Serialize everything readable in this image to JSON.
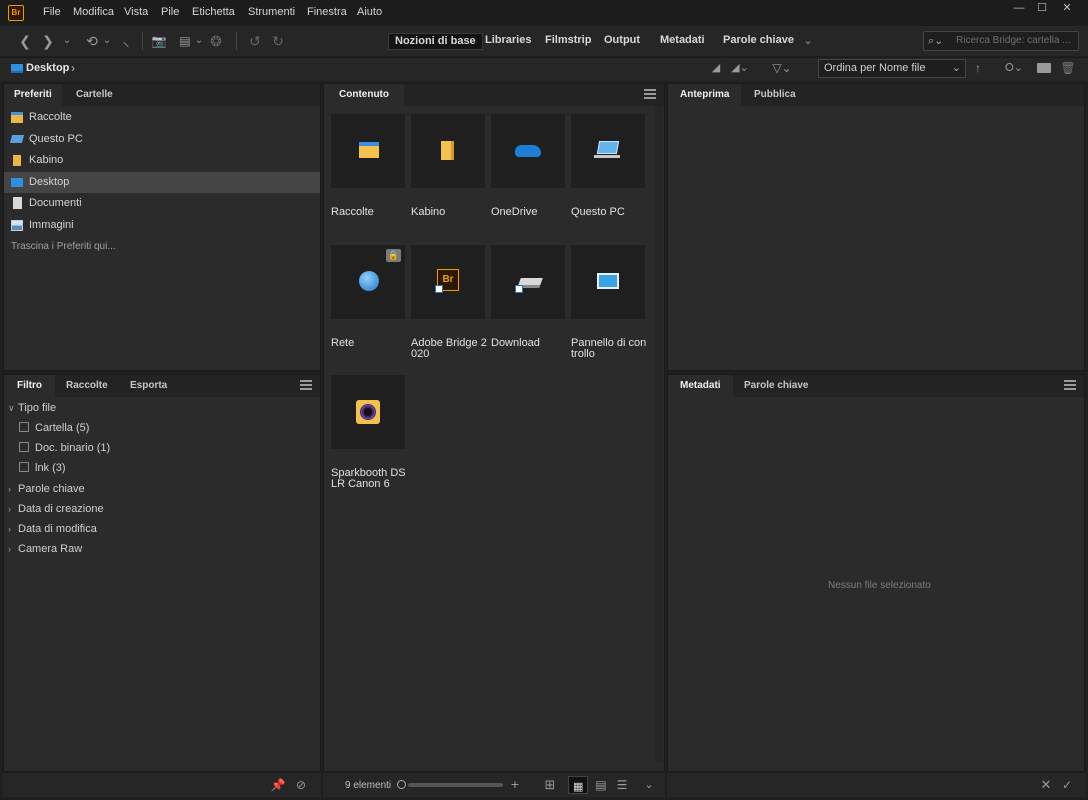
{
  "app": {
    "logo_text": "Br"
  },
  "menu": [
    "File",
    "Modifica",
    "Vista",
    "Pile",
    "Etichetta",
    "Strumenti",
    "Finestra",
    "Aiuto"
  ],
  "window_controls": {
    "minimize": "—",
    "maximize": "☐",
    "close": "✕"
  },
  "workspaces": [
    "Nozioni di base",
    "Libraries",
    "Filmstrip",
    "Output",
    "Metadati",
    "Parole chiave"
  ],
  "workspace_active": "Nozioni di base",
  "search": {
    "placeholder": "Ricerca Bridge: cartella ..."
  },
  "path": {
    "current": "Desktop",
    "separator": "›"
  },
  "sort": {
    "label": "Ordina per Nome file",
    "arrow": "⌄",
    "direction_icon": "↑"
  },
  "left_top": {
    "tabs": [
      "Preferiti",
      "Cartelle"
    ],
    "items": [
      {
        "label": "Raccolte",
        "icon": "collections-icon",
        "color": "#4a90d9"
      },
      {
        "label": "Questo PC",
        "icon": "computer-icon",
        "color": "#5aa0e0"
      },
      {
        "label": "Kabino",
        "icon": "user-folder-icon",
        "color": "#e8b84a"
      },
      {
        "label": "Desktop",
        "icon": "desktop-icon",
        "color": "#2f8fe0"
      },
      {
        "label": "Documenti",
        "icon": "documents-icon",
        "color": "#c9c9c9"
      },
      {
        "label": "Immagini",
        "icon": "pictures-icon",
        "color": "#7aa8d0"
      }
    ],
    "drop_hint": "Trascina i Preferiti qui..."
  },
  "left_bottom": {
    "tabs": [
      "Filtro",
      "Raccolte",
      "Esporta"
    ],
    "tipo_file": "Tipo file",
    "checks": [
      {
        "label": "Cartella",
        "count": "(5)"
      },
      {
        "label": "Doc. binario",
        "count": "(1)"
      },
      {
        "label": "lnk",
        "count": "(3)"
      }
    ],
    "groups": [
      "Parole chiave",
      "Data di creazione",
      "Data di modifica",
      "Camera Raw"
    ]
  },
  "content": {
    "tab": "Contenuto",
    "items": [
      {
        "label": "Raccolte",
        "icon": "collections-folder-icon"
      },
      {
        "label": "Kabino",
        "icon": "user-folder-icon"
      },
      {
        "label": "OneDrive",
        "icon": "onedrive-cloud-icon"
      },
      {
        "label": "Questo PC",
        "icon": "laptop-icon"
      },
      {
        "label": "Rete",
        "icon": "network-globe-icon"
      },
      {
        "label": "Adobe Bridge 2020",
        "icon": "bridge-app-icon"
      },
      {
        "label": "Download",
        "icon": "download-drive-icon"
      },
      {
        "label": "Pannello di controllo",
        "icon": "control-panel-icon"
      },
      {
        "label": "Sparkbooth DSLR Canon 6",
        "icon": "sparkbooth-icon"
      }
    ],
    "count_label": "9 elementi"
  },
  "right_top": {
    "tabs": [
      "Anteprima",
      "Pubblica"
    ]
  },
  "right_bottom": {
    "tabs": [
      "Metadati",
      "Parole chiave"
    ],
    "empty": "Nessun file selezionato"
  },
  "colors": {
    "accent_bridge": "#f19a00",
    "selection": "#454545"
  }
}
